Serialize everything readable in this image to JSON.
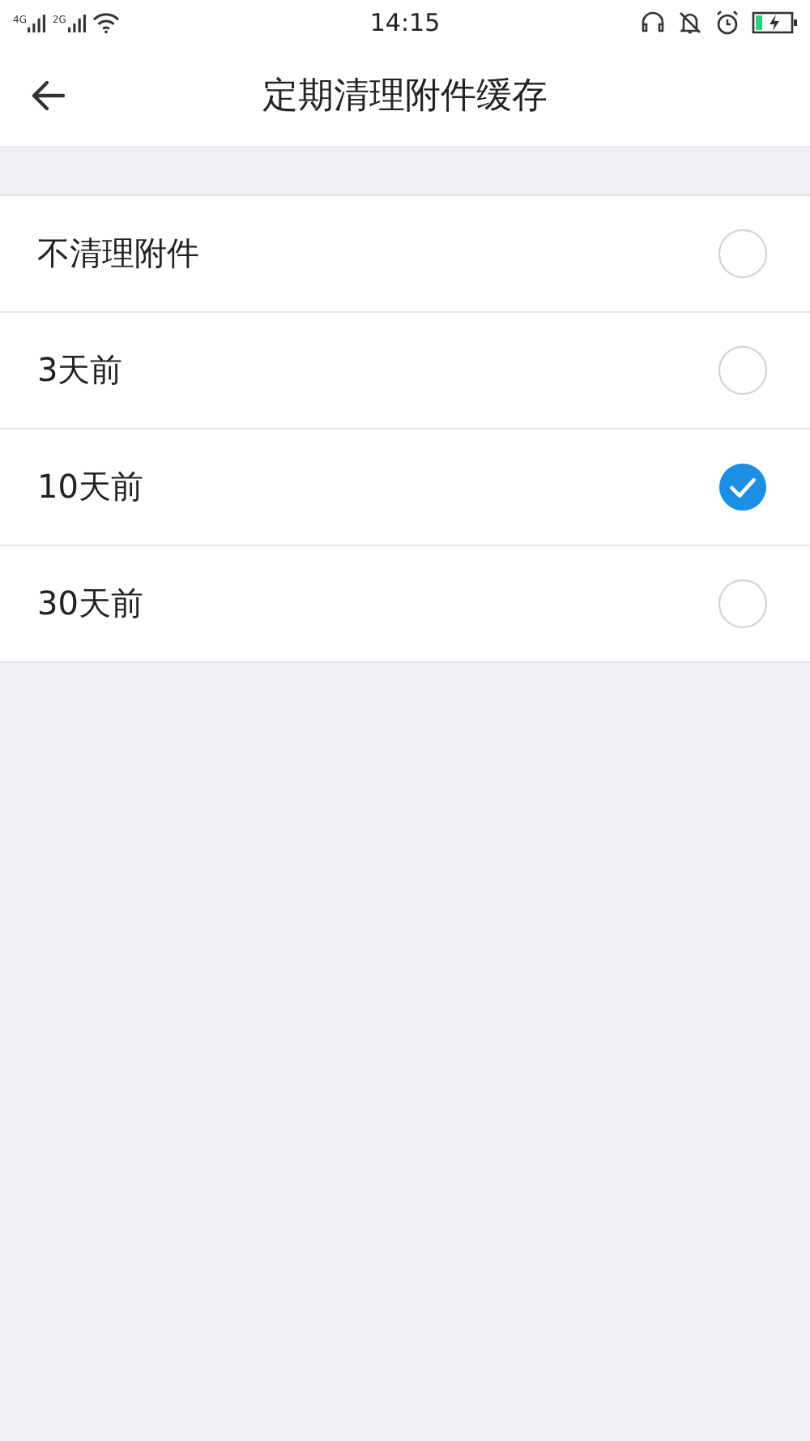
{
  "status_bar": {
    "networks": [
      "4G",
      "2G"
    ],
    "time": "14:15"
  },
  "header": {
    "title": "定期清理附件缓存"
  },
  "options": [
    {
      "label": "不清理附件",
      "selected": false
    },
    {
      "label": "3天前",
      "selected": false
    },
    {
      "label": "10天前",
      "selected": true
    },
    {
      "label": "30天前",
      "selected": false
    }
  ]
}
